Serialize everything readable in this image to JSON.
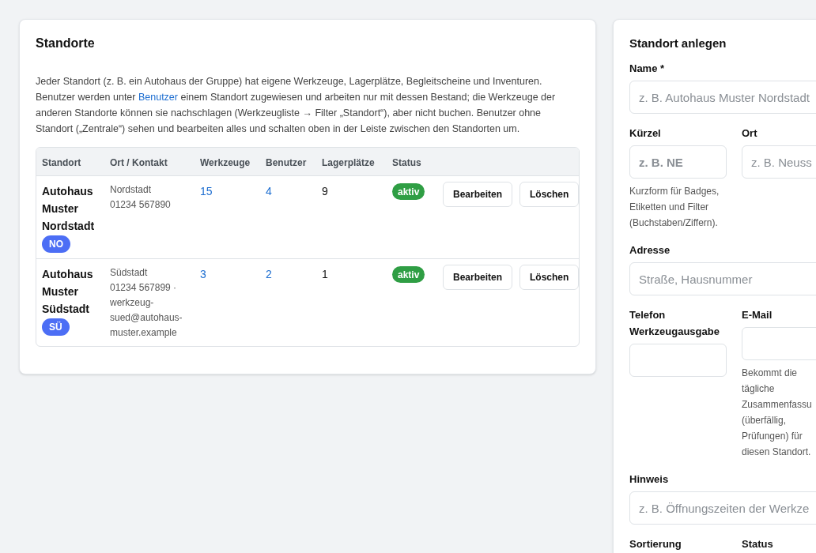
{
  "locations_panel": {
    "title": "Standorte",
    "intro": {
      "before": "Jeder Standort (z. B. ein Autohaus der Gruppe) hat eigene Werkzeuge, Lagerplätze, Begleitscheine und Inventuren. Benutzer werden unter ",
      "link": "Benutzer",
      "after": " einem Standort zugewiesen und arbeiten nur mit dessen Bestand; die Werkzeuge der anderen Standorte können sie nachschlagen (Werkzeugliste → Filter „Standort“), aber nicht buchen. Benutzer ohne Standort („Zentrale“) sehen und bearbeiten alles und schalten oben in der Leiste zwischen den Standorten um."
    },
    "table": {
      "columns": [
        "Standort",
        "Ort / Kontakt",
        "Werkzeuge",
        "Benutzer",
        "Lagerplätze",
        "Status"
      ],
      "rows": [
        {
          "name": "Autohaus Muster Nordstadt",
          "code": "NO",
          "city": "Nordstadt",
          "contact": "01234 567890",
          "tools": "15",
          "users": "4",
          "storage_places": "9",
          "status": "aktiv",
          "actions": [
            "Bearbeiten",
            "Löschen"
          ]
        },
        {
          "name": "Autohaus Muster Südstadt",
          "code": "SÜ",
          "city": "Südstadt",
          "contact": "01234 567899 · werkzeug-sued@autohaus-muster.example",
          "tools": "3",
          "users": "2",
          "storage_places": "1",
          "status": "aktiv",
          "actions": [
            "Bearbeiten",
            "Löschen"
          ]
        }
      ]
    }
  },
  "create_panel": {
    "title": "Standort anlegen",
    "rows": [
      {
        "fields": [
          {
            "kind": "text_input",
            "label": "Name *",
            "placeholder": "z. B. Autohaus Muster Nordstadt"
          }
        ]
      },
      {
        "fields": [
          {
            "kind": "code_input",
            "label": "Kürzel",
            "placeholder": "z. B. NE",
            "hint": "Kurzform für Badges, Etiketten und Filter (Buchstaben/Ziffern)."
          },
          {
            "kind": "text_input",
            "label": "Ort",
            "placeholder": "z. B. Neuss"
          }
        ]
      },
      {
        "fields": [
          {
            "kind": "text_input",
            "label": "Adresse",
            "placeholder": "Straße, Hausnummer"
          }
        ]
      },
      {
        "fields": [
          {
            "kind": "text_input",
            "label": "Telefon Werkzeugausgabe"
          },
          {
            "kind": "text_input",
            "label": "E-Mail",
            "hint": "Bekommt die tägliche Zusammenfassu (überfällig, Prüfungen) für diesen Standort."
          }
        ]
      },
      {
        "fields": [
          {
            "kind": "text_input",
            "label": "Hinweis",
            "placeholder": "z. B. Öffnungszeiten der Werkze"
          }
        ]
      },
      {
        "fields": [
          {
            "kind": "label_only",
            "label": "Sortierung"
          },
          {
            "kind": "label_only",
            "label": "Status"
          }
        ]
      }
    ]
  }
}
